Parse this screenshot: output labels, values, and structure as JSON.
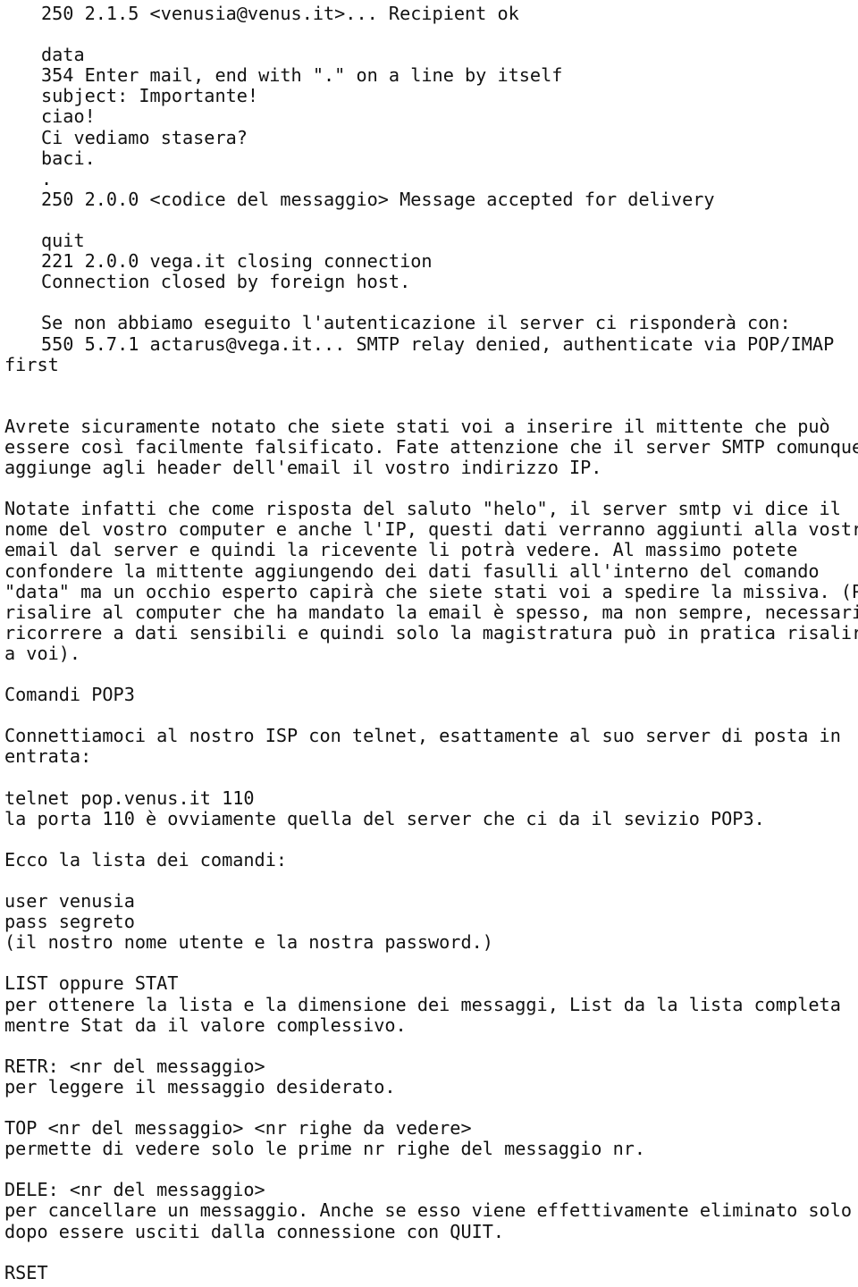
{
  "document": {
    "type": "plain-text-page",
    "language": "it",
    "topic": "Comandi SMTP e POP3 via telnet",
    "background_color": "#ffffff",
    "text_color": "#121212",
    "lines": [
      {
        "id": "l1",
        "indent": true,
        "text": "250 2.1.5 <venusia@venus.it>... Recipient ok"
      },
      {
        "id": "l2",
        "indent": true,
        "text": ""
      },
      {
        "id": "l3",
        "indent": true,
        "text": "data"
      },
      {
        "id": "l4",
        "indent": true,
        "text": "354 Enter mail, end with \".\" on a line by itself"
      },
      {
        "id": "l5",
        "indent": true,
        "text": "subject: Importante!"
      },
      {
        "id": "l6",
        "indent": true,
        "text": "ciao!"
      },
      {
        "id": "l7",
        "indent": true,
        "text": "Ci vediamo stasera?"
      },
      {
        "id": "l8",
        "indent": true,
        "text": "baci."
      },
      {
        "id": "l9",
        "indent": true,
        "text": "."
      },
      {
        "id": "l10",
        "indent": true,
        "text": "250 2.0.0 <codice del messaggio> Message accepted for delivery"
      },
      {
        "id": "l11",
        "indent": true,
        "text": ""
      },
      {
        "id": "l12",
        "indent": true,
        "text": "quit"
      },
      {
        "id": "l13",
        "indent": true,
        "text": "221 2.0.0 vega.it closing connection"
      },
      {
        "id": "l14",
        "indent": true,
        "text": "Connection closed by foreign host."
      },
      {
        "id": "l15",
        "indent": true,
        "text": ""
      },
      {
        "id": "l16",
        "indent": true,
        "text": "Se non abbiamo eseguito l'autenticazione il server ci risponderà con:"
      },
      {
        "id": "l17",
        "indent": true,
        "text": "550 5.7.1 actarus@vega.it... SMTP relay denied, authenticate via POP/IMAP"
      },
      {
        "id": "l18",
        "indent": false,
        "text": "first"
      },
      {
        "id": "l19",
        "indent": false,
        "text": ""
      },
      {
        "id": "l20",
        "indent": false,
        "text": ""
      },
      {
        "id": "l21",
        "indent": false,
        "text": "Avrete sicuramente notato che siete stati voi a inserire il mittente che può"
      },
      {
        "id": "l22",
        "indent": false,
        "text": "essere così facilmente falsificato. Fate attenzione che il server SMTP comunque"
      },
      {
        "id": "l23",
        "indent": false,
        "text": "aggiunge agli header dell'email il vostro indirizzo IP."
      },
      {
        "id": "l24",
        "indent": false,
        "text": ""
      },
      {
        "id": "l25",
        "indent": false,
        "text": "Notate infatti che come risposta del saluto \"helo\", il server smtp vi dice il"
      },
      {
        "id": "l26",
        "indent": false,
        "text": "nome del vostro computer e anche l'IP, questi dati verranno aggiunti alla vostra"
      },
      {
        "id": "l27",
        "indent": false,
        "text": "email dal server e quindi la ricevente li potrà vedere. Al massimo potete"
      },
      {
        "id": "l28",
        "indent": false,
        "text": "confondere la mittente aggiungendo dei dati fasulli all'interno del comando"
      },
      {
        "id": "l29",
        "indent": false,
        "text": "\"data\" ma un occhio esperto capirà che siete stati voi a spedire la missiva. (Per"
      },
      {
        "id": "l30",
        "indent": false,
        "text": "risalire al computer che ha mandato la email è spesso, ma non sempre, necessario"
      },
      {
        "id": "l31",
        "indent": false,
        "text": "ricorrere a dati sensibili e quindi solo la magistratura può in pratica risalire"
      },
      {
        "id": "l32",
        "indent": false,
        "text": "a voi)."
      },
      {
        "id": "l33",
        "indent": false,
        "text": ""
      },
      {
        "id": "l34",
        "indent": false,
        "text": "Comandi POP3"
      },
      {
        "id": "l35",
        "indent": false,
        "text": ""
      },
      {
        "id": "l36",
        "indent": false,
        "text": "Connettiamoci al nostro ISP con telnet, esattamente al suo server di posta in"
      },
      {
        "id": "l37",
        "indent": false,
        "text": "entrata:"
      },
      {
        "id": "l38",
        "indent": false,
        "text": ""
      },
      {
        "id": "l39",
        "indent": false,
        "text": "telnet pop.venus.it 110"
      },
      {
        "id": "l40",
        "indent": false,
        "text": "la porta 110 è ovviamente quella del server che ci da il sevizio POP3."
      },
      {
        "id": "l41",
        "indent": false,
        "text": ""
      },
      {
        "id": "l42",
        "indent": false,
        "text": "Ecco la lista dei comandi:"
      },
      {
        "id": "l43",
        "indent": false,
        "text": ""
      },
      {
        "id": "l44",
        "indent": false,
        "text": "user venusia"
      },
      {
        "id": "l45",
        "indent": false,
        "text": "pass segreto"
      },
      {
        "id": "l46",
        "indent": false,
        "text": "(il nostro nome utente e la nostra password.)"
      },
      {
        "id": "l47",
        "indent": false,
        "text": ""
      },
      {
        "id": "l48",
        "indent": false,
        "text": "LIST oppure STAT"
      },
      {
        "id": "l49",
        "indent": false,
        "text": "per ottenere la lista e la dimensione dei messaggi, List da la lista completa"
      },
      {
        "id": "l50",
        "indent": false,
        "text": "mentre Stat da il valore complessivo."
      },
      {
        "id": "l51",
        "indent": false,
        "text": ""
      },
      {
        "id": "l52",
        "indent": false,
        "text": "RETR: <nr del messaggio>"
      },
      {
        "id": "l53",
        "indent": false,
        "text": "per leggere il messaggio desiderato."
      },
      {
        "id": "l54",
        "indent": false,
        "text": ""
      },
      {
        "id": "l55",
        "indent": false,
        "text": "TOP <nr del messaggio> <nr righe da vedere>"
      },
      {
        "id": "l56",
        "indent": false,
        "text": "permette di vedere solo le prime nr righe del messaggio nr."
      },
      {
        "id": "l57",
        "indent": false,
        "text": ""
      },
      {
        "id": "l58",
        "indent": false,
        "text": "DELE: <nr del messaggio>"
      },
      {
        "id": "l59",
        "indent": false,
        "text": "per cancellare un messaggio. Anche se esso viene effettivamente eliminato solo"
      },
      {
        "id": "l60",
        "indent": false,
        "text": "dopo essere usciti dalla connessione con QUIT."
      },
      {
        "id": "l61",
        "indent": false,
        "text": ""
      },
      {
        "id": "l62",
        "indent": false,
        "text": "RSET"
      }
    ]
  }
}
